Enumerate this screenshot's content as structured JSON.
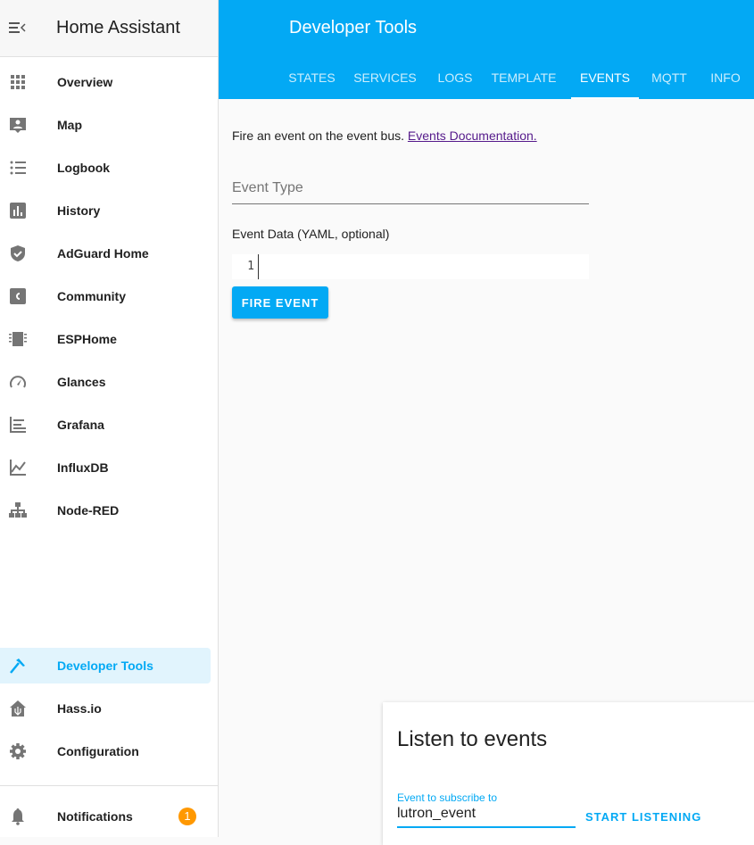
{
  "sidebar": {
    "title": "Home Assistant",
    "items": [
      {
        "label": "Overview",
        "icon": "grid-icon"
      },
      {
        "label": "Map",
        "icon": "map-person-icon"
      },
      {
        "label": "Logbook",
        "icon": "list-icon"
      },
      {
        "label": "History",
        "icon": "chart-bar-icon"
      },
      {
        "label": "AdGuard Home",
        "icon": "shield-check-icon"
      },
      {
        "label": "Community",
        "icon": "community-icon"
      },
      {
        "label": "ESPHome",
        "icon": "chip-icon"
      },
      {
        "label": "Glances",
        "icon": "speedometer-icon"
      },
      {
        "label": "Grafana",
        "icon": "grafana-icon"
      },
      {
        "label": "InfluxDB",
        "icon": "line-chart-icon"
      },
      {
        "label": "Node-RED",
        "icon": "sitemap-icon"
      }
    ],
    "bottom": [
      {
        "label": "Developer Tools",
        "icon": "hammer-icon",
        "active": true
      },
      {
        "label": "Hass.io",
        "icon": "home-assistant-icon"
      },
      {
        "label": "Configuration",
        "icon": "gear-icon"
      }
    ],
    "notifications": {
      "label": "Notifications",
      "count": "1"
    }
  },
  "header": {
    "title": "Developer Tools",
    "tabs": [
      "STATES",
      "SERVICES",
      "LOGS",
      "TEMPLATE",
      "EVENTS",
      "MQTT",
      "INFO"
    ],
    "active_tab": "EVENTS"
  },
  "main": {
    "description": "Fire an event on the event bus.",
    "doc_link": "Events Documentation.",
    "event_type_placeholder": "Event Type",
    "event_data_label": "Event Data (YAML, optional)",
    "line_number": "1",
    "fire_button": "FIRE EVENT"
  },
  "listen": {
    "title": "Listen to events",
    "field_label": "Event to subscribe to",
    "field_value": "lutron_event",
    "start_button": "START LISTENING"
  },
  "colors": {
    "accent": "#03a9f4",
    "badge": "#ff9800",
    "link": "#551a8b"
  }
}
